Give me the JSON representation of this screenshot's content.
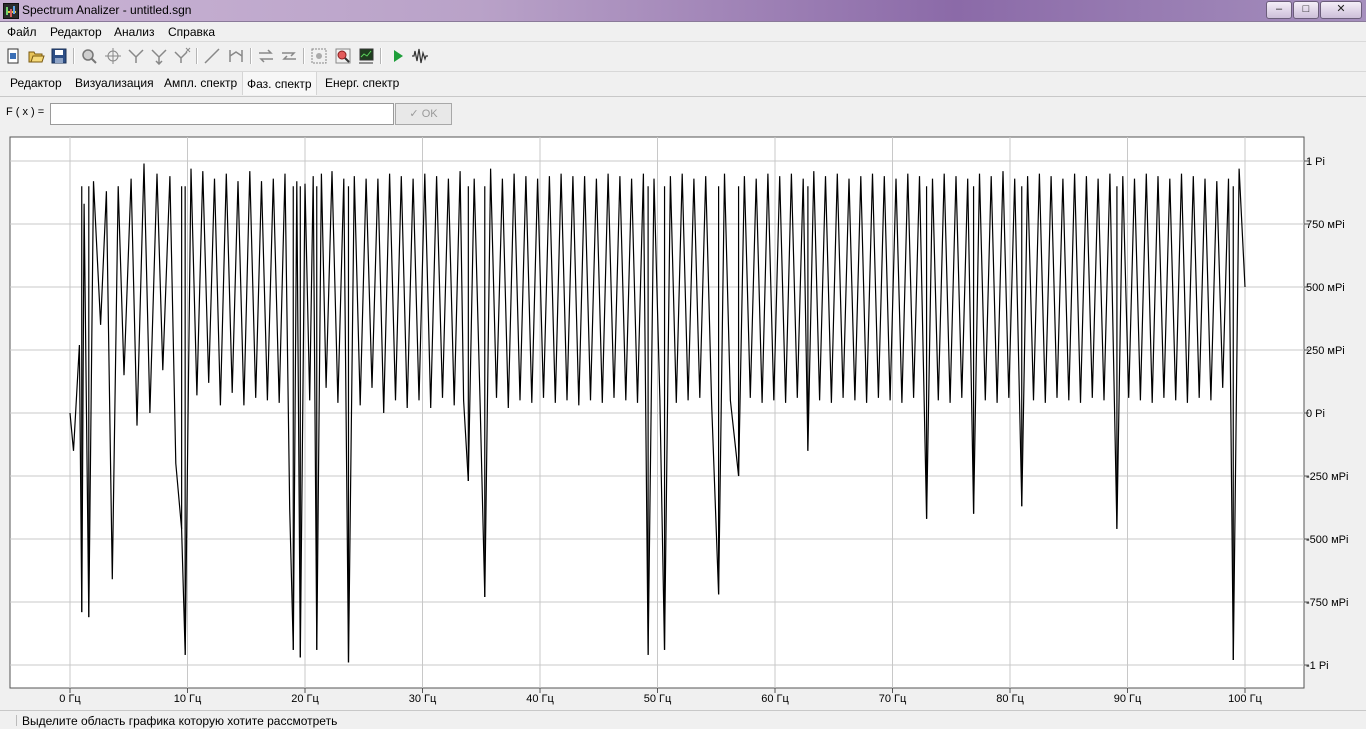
{
  "window": {
    "title": "Spectrum Analizer - untitled.sgn",
    "controls": {
      "minimize": "–",
      "maximize": "□",
      "close": "✕"
    }
  },
  "menu": [
    {
      "label": "Файл"
    },
    {
      "label": "Редактор"
    },
    {
      "label": "Анализ"
    },
    {
      "label": "Справка"
    }
  ],
  "toolbar": {
    "buttons": [
      "new-icon",
      "open-icon",
      "save-icon",
      "zoom-icon",
      "crosshair-icon",
      "filter-icon",
      "filter-down-icon",
      "filter-x-icon",
      "line-icon",
      "bracket-icon",
      "swap-icon",
      "swap-alt-icon",
      "zoom-region-icon",
      "zoom-reset-icon",
      "chart-icon",
      "play-icon",
      "wave-icon"
    ]
  },
  "tabs": [
    {
      "label": "Редактор",
      "active": false
    },
    {
      "label": "Визуализация",
      "active": false
    },
    {
      "label": "Ампл. спектр",
      "active": false
    },
    {
      "label": "Фаз. спектр",
      "active": true
    },
    {
      "label": "Енерг. спектр",
      "active": false
    }
  ],
  "formula": {
    "label": "F ( x ) =",
    "value": "",
    "ok_label": "OK"
  },
  "chart_data": {
    "type": "line",
    "x_ticks": [
      0,
      10,
      20,
      30,
      40,
      50,
      60,
      70,
      80,
      90,
      100
    ],
    "x_tick_labels": [
      "0 Гц",
      "10 Гц",
      "20 Гц",
      "30 Гц",
      "40 Гц",
      "50 Гц",
      "60 Гц",
      "70 Гц",
      "80 Гц",
      "90 Гц",
      "100 Гц"
    ],
    "y_ticks": [
      1,
      0.75,
      0.5,
      0.25,
      0,
      -0.25,
      -0.5,
      -0.75,
      -1
    ],
    "y_tick_labels": [
      "1 Pi",
      "750 мPi",
      "500 мPi",
      "250 мPi",
      "0 Pi",
      "-250 мPi",
      "-500 мPi",
      "-750 мPi",
      "-1 Pi"
    ],
    "xlim": [
      0,
      100
    ],
    "ylim": [
      -1,
      1
    ],
    "grid": true,
    "deep_dips": [
      [
        1.0,
        -0.79
      ],
      [
        1.6,
        -0.81
      ],
      [
        9.5,
        -0.46
      ],
      [
        9.8,
        -0.96
      ],
      [
        19,
        -0.94
      ],
      [
        19.6,
        -0.97
      ],
      [
        21,
        -0.94
      ],
      [
        23.7,
        -0.99
      ],
      [
        33.9,
        -0.27
      ],
      [
        35.3,
        -0.73
      ],
      [
        49.2,
        -0.96
      ],
      [
        50.6,
        -0.94
      ],
      [
        55.2,
        -0.72
      ],
      [
        56.9,
        -0.25
      ],
      [
        62.8,
        -0.15
      ],
      [
        72.9,
        -0.42
      ],
      [
        76.9,
        -0.4
      ],
      [
        81,
        -0.37
      ],
      [
        89.1,
        -0.46
      ],
      [
        99,
        -0.98
      ]
    ],
    "series": [
      {
        "x": [
          0,
          0.3,
          0.8,
          1.0,
          1.2,
          1.6,
          2.0,
          2.6,
          3.1,
          3.6,
          4.1,
          4.6,
          5.2,
          5.7,
          6.3,
          6.8,
          7.4,
          7.9,
          8.5,
          9.0,
          9.5,
          9.8,
          10.3,
          10.8,
          11.3,
          11.8,
          12.3,
          12.8,
          13.3,
          13.8,
          14.3,
          14.8,
          15.3,
          15.8,
          16.3,
          16.8,
          17.3,
          17.8,
          18.3,
          18.7,
          19.0,
          19.3,
          19.6,
          20.0,
          20.4,
          20.7,
          21.0,
          21.4,
          21.8,
          22.3,
          22.8,
          23.3,
          23.7,
          24.2,
          24.7,
          25.2,
          25.7,
          26.2,
          26.7,
          27.2,
          27.7,
          28.2,
          28.7,
          29.2,
          29.7,
          30.2,
          30.7,
          31.2,
          31.7,
          32.2,
          32.7,
          33.2,
          33.5,
          33.9,
          34.4,
          34.9,
          35.3,
          35.8,
          36.3,
          36.8,
          37.3,
          37.8,
          38.3,
          38.8,
          39.3,
          39.8,
          40.3,
          40.8,
          41.3,
          41.8,
          42.3,
          42.8,
          43.3,
          43.8,
          44.3,
          44.8,
          45.3,
          45.8,
          46.3,
          46.8,
          47.3,
          47.8,
          48.3,
          48.8,
          49.2,
          49.7,
          50.2,
          50.6,
          51.1,
          51.6,
          52.1,
          52.6,
          53.1,
          53.6,
          54.1,
          54.6,
          55.2,
          55.7,
          56.2,
          56.9,
          57.4,
          57.9,
          58.4,
          58.9,
          59.4,
          59.9,
          60.4,
          60.9,
          61.4,
          61.9,
          62.4,
          62.8,
          63.3,
          63.8,
          64.3,
          64.8,
          65.3,
          65.8,
          66.3,
          66.8,
          67.3,
          67.8,
          68.3,
          68.8,
          69.3,
          69.8,
          70.3,
          70.8,
          71.3,
          71.8,
          72.3,
          72.9,
          73.4,
          73.9,
          74.4,
          74.9,
          75.4,
          75.9,
          76.4,
          76.9,
          77.4,
          77.9,
          78.4,
          78.9,
          79.4,
          79.9,
          80.4,
          81.0,
          81.5,
          82.0,
          82.5,
          83.0,
          83.5,
          84.0,
          84.5,
          85.0,
          85.5,
          86.0,
          86.5,
          87.0,
          87.5,
          88.0,
          88.5,
          89.1,
          89.6,
          90.1,
          90.6,
          91.1,
          91.6,
          92.1,
          92.6,
          93.1,
          93.6,
          94.1,
          94.6,
          95.1,
          95.6,
          96.1,
          96.6,
          97.1,
          97.6,
          98.1,
          98.6,
          99.0,
          99.5,
          100
        ],
        "y": [
          0,
          -0.15,
          0.27,
          -0.79,
          0.83,
          -0.81,
          0.92,
          0.35,
          0.88,
          -0.66,
          0.9,
          0.15,
          0.93,
          -0.05,
          0.99,
          0.0,
          0.95,
          0.17,
          0.94,
          -0.2,
          -0.46,
          -0.96,
          0.97,
          0.07,
          0.96,
          0.12,
          0.93,
          0.03,
          0.95,
          0.08,
          0.92,
          0.03,
          0.96,
          0.06,
          0.92,
          0.05,
          0.93,
          0.04,
          0.95,
          -0.38,
          -0.94,
          0.92,
          -0.97,
          0.91,
          0.05,
          0.94,
          -0.94,
          0.95,
          0.1,
          0.96,
          0.04,
          0.93,
          -0.99,
          0.94,
          0.03,
          0.93,
          0.1,
          0.93,
          0.0,
          0.95,
          0.05,
          0.94,
          0.02,
          0.93,
          0.05,
          0.95,
          0.02,
          0.94,
          0.06,
          0.93,
          0.03,
          0.96,
          0.05,
          -0.27,
          0.93,
          0.04,
          -0.73,
          0.97,
          0.06,
          0.93,
          0.02,
          0.95,
          0.05,
          0.94,
          0.04,
          0.93,
          0.06,
          0.94,
          0.04,
          0.95,
          0.05,
          0.94,
          0.03,
          0.94,
          0.05,
          0.93,
          0.04,
          0.95,
          0.06,
          0.94,
          0.05,
          0.93,
          0.04,
          0.95,
          -0.96,
          0.93,
          0.05,
          -0.94,
          0.94,
          0.04,
          0.95,
          0.05,
          0.93,
          0.06,
          0.94,
          0.04,
          -0.72,
          0.95,
          0.05,
          -0.25,
          0.94,
          0.06,
          0.93,
          0.04,
          0.95,
          0.05,
          0.94,
          0.04,
          0.95,
          0.06,
          0.93,
          -0.15,
          0.96,
          0.05,
          0.94,
          0.04,
          0.95,
          0.06,
          0.93,
          0.05,
          0.94,
          0.04,
          0.95,
          0.06,
          0.94,
          0.05,
          0.93,
          0.04,
          0.95,
          0.06,
          0.94,
          -0.42,
          0.93,
          0.05,
          0.95,
          0.04,
          0.94,
          0.06,
          0.93,
          -0.4,
          0.95,
          0.05,
          0.94,
          0.04,
          0.96,
          0.06,
          0.93,
          -0.37,
          0.94,
          0.05,
          0.95,
          0.04,
          0.94,
          0.06,
          0.93,
          0.05,
          0.95,
          0.04,
          0.94,
          0.06,
          0.93,
          0.05,
          0.95,
          -0.46,
          0.94,
          0.06,
          0.93,
          0.05,
          0.95,
          0.04,
          0.94,
          0.06,
          0.93,
          0.05,
          0.95,
          0.04,
          0.94,
          0.06,
          0.93,
          0.05,
          0.92,
          0.1,
          0.93,
          -0.98,
          0.97,
          0.5
        ]
      }
    ]
  },
  "status": {
    "text": "Выделите область графика которую хотите рассмотреть"
  }
}
